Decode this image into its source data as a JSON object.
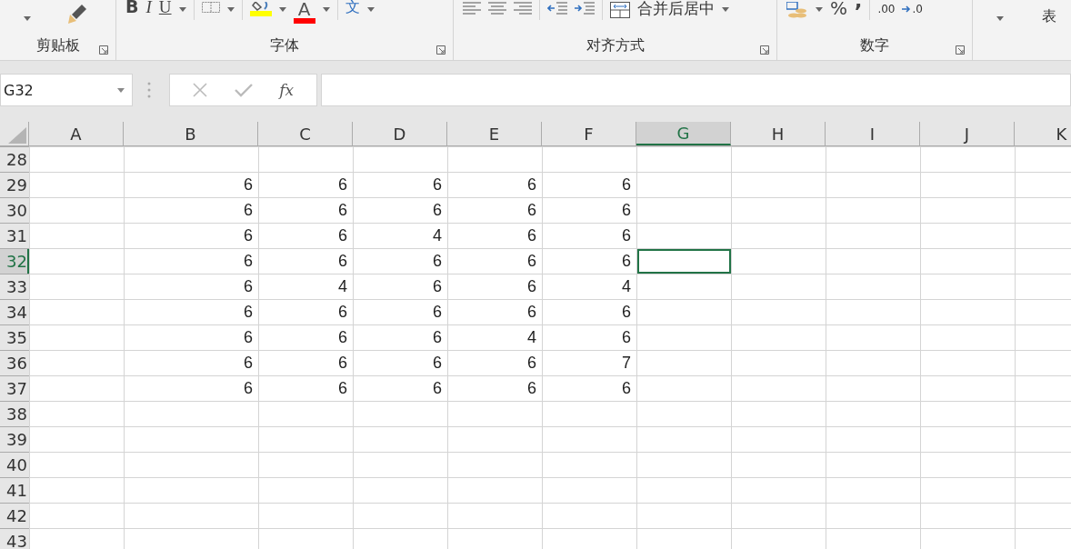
{
  "ribbon": {
    "groups": [
      {
        "kind": "clipboard",
        "label": "剪贴板"
      },
      {
        "kind": "font",
        "label": "字体",
        "buttons": [
          "B",
          "I",
          "U"
        ],
        "font_color": "A",
        "phonetic": "文"
      },
      {
        "kind": "alignment",
        "label": "对齐方式",
        "merge": "合并后居中"
      },
      {
        "kind": "number",
        "label": "数字",
        "percent": "%",
        "comma": ",",
        "decimals": [
          ".00",
          ".0"
        ]
      },
      {
        "kind": "styles",
        "table": "表"
      }
    ]
  },
  "name_box": {
    "value": "G32"
  },
  "formula_bar": {
    "fx": "fx"
  },
  "columns": [
    {
      "label": "A",
      "selected": false
    },
    {
      "label": "B",
      "selected": false
    },
    {
      "label": "C",
      "selected": false
    },
    {
      "label": "D",
      "selected": false
    },
    {
      "label": "E",
      "selected": false
    },
    {
      "label": "F",
      "selected": false
    },
    {
      "label": "G",
      "selected": true
    },
    {
      "label": "H",
      "selected": false
    },
    {
      "label": "I",
      "selected": false
    },
    {
      "label": "J",
      "selected": false
    },
    {
      "label": "K",
      "selected": false
    }
  ],
  "rows": [
    {
      "header": "28",
      "selected": false,
      "values": []
    },
    {
      "header": "29",
      "selected": false,
      "values": [
        "6",
        "6",
        "6",
        "6",
        "6"
      ]
    },
    {
      "header": "30",
      "selected": false,
      "values": [
        "6",
        "6",
        "6",
        "6",
        "6"
      ]
    },
    {
      "header": "31",
      "selected": false,
      "values": [
        "6",
        "6",
        "4",
        "6",
        "6"
      ]
    },
    {
      "header": "32",
      "selected": true,
      "values": [
        "6",
        "6",
        "6",
        "6",
        "6"
      ]
    },
    {
      "header": "33",
      "selected": false,
      "values": [
        "6",
        "4",
        "6",
        "6",
        "4"
      ]
    },
    {
      "header": "34",
      "selected": false,
      "values": [
        "6",
        "6",
        "6",
        "6",
        "6"
      ]
    },
    {
      "header": "35",
      "selected": false,
      "values": [
        "6",
        "6",
        "6",
        "4",
        "6"
      ]
    },
    {
      "header": "36",
      "selected": false,
      "values": [
        "6",
        "6",
        "6",
        "6",
        "7"
      ]
    },
    {
      "header": "37",
      "selected": false,
      "values": [
        "6",
        "6",
        "6",
        "6",
        "6"
      ]
    },
    {
      "header": "38",
      "selected": false,
      "values": []
    },
    {
      "header": "39",
      "selected": false,
      "values": []
    },
    {
      "header": "40",
      "selected": false,
      "values": []
    },
    {
      "header": "41",
      "selected": false,
      "values": []
    },
    {
      "header": "42",
      "selected": false,
      "values": []
    },
    {
      "header": "43",
      "selected": false,
      "values": []
    }
  ]
}
